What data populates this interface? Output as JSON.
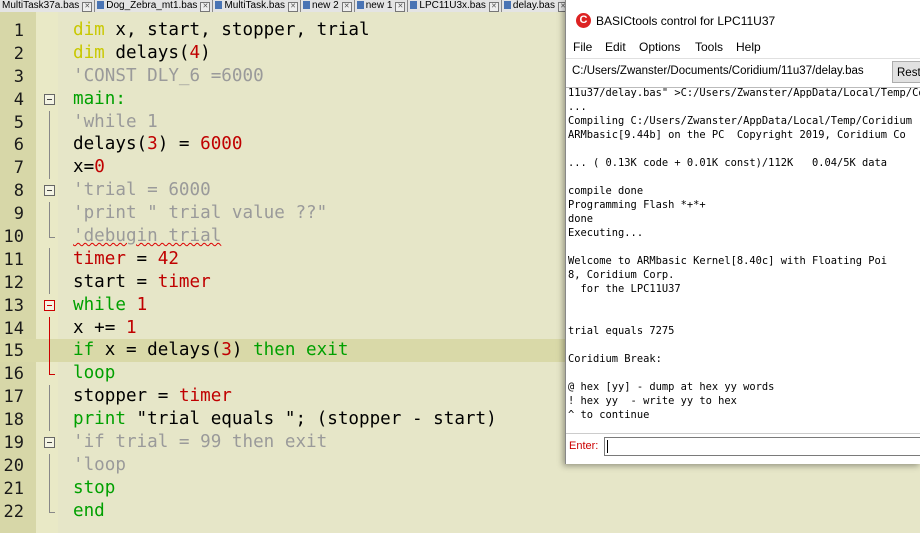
{
  "tabs": [
    {
      "label": "MultiTask37a.bas"
    },
    {
      "label": "Dog_Zebra_mt1.bas"
    },
    {
      "label": "MultiTask.bas"
    },
    {
      "label": "new 2"
    },
    {
      "label": "new 1"
    },
    {
      "label": "LPC11U3x.bas"
    },
    {
      "label": "delay.bas"
    }
  ],
  "colors": {
    "keyword": "#c8c800",
    "identifier": "#000000",
    "number": "#c00000",
    "comment": "#9a9a9a",
    "flow_keyword": "#00a000",
    "operator": "#c00000",
    "timer": "#c00000",
    "string": "#000000"
  },
  "editor": {
    "current_line": 15,
    "lines": [
      {
        "num": "1",
        "tokens": [
          [
            "kw",
            "dim"
          ],
          [
            "id",
            " x, start, stopper, trial"
          ]
        ]
      },
      {
        "num": "2",
        "tokens": [
          [
            "kw",
            "dim"
          ],
          [
            "id",
            " delays("
          ],
          [
            "num",
            "4"
          ],
          [
            "id",
            ")"
          ]
        ]
      },
      {
        "num": "3",
        "tokens": [
          [
            "cm",
            "'CONST DLY_6 =6000"
          ]
        ]
      },
      {
        "num": "4",
        "tokens": [
          [
            "fk",
            "main:"
          ]
        ]
      },
      {
        "num": "5",
        "tokens": [
          [
            "cm",
            "'while 1"
          ]
        ]
      },
      {
        "num": "6",
        "tokens": [
          [
            "id",
            "delays("
          ],
          [
            "num",
            "3"
          ],
          [
            "id",
            ") = "
          ],
          [
            "num",
            "6000"
          ]
        ]
      },
      {
        "num": "7",
        "tokens": [
          [
            "id",
            "x="
          ],
          [
            "num",
            "0"
          ]
        ]
      },
      {
        "num": "8",
        "tokens": [
          [
            "cm",
            "'trial = 6000"
          ]
        ]
      },
      {
        "num": "9",
        "tokens": [
          [
            "cm",
            "'print \" trial value ??\""
          ]
        ]
      },
      {
        "num": "10",
        "tokens": [
          [
            "cm",
            "'debugin trial"
          ]
        ]
      },
      {
        "num": "11",
        "tokens": [
          [
            "tm",
            "timer"
          ],
          [
            "id",
            " = "
          ],
          [
            "num",
            "42"
          ]
        ]
      },
      {
        "num": "12",
        "tokens": [
          [
            "id",
            "start = "
          ],
          [
            "tm",
            "timer"
          ]
        ]
      },
      {
        "num": "13",
        "tokens": [
          [
            "fk",
            "while"
          ],
          [
            "id",
            " "
          ],
          [
            "num",
            "1"
          ]
        ]
      },
      {
        "num": "14",
        "tokens": [
          [
            "id",
            "x += "
          ],
          [
            "num",
            "1"
          ]
        ]
      },
      {
        "num": "15",
        "tokens": [
          [
            "fk",
            "if"
          ],
          [
            "id",
            " x = delays("
          ],
          [
            "num",
            "3"
          ],
          [
            "id",
            ") "
          ],
          [
            "fk",
            "then"
          ],
          [
            "id",
            " "
          ],
          [
            "fk",
            "exit"
          ]
        ]
      },
      {
        "num": "16",
        "tokens": [
          [
            "fk",
            "loop"
          ]
        ]
      },
      {
        "num": "17",
        "tokens": [
          [
            "id",
            "stopper = "
          ],
          [
            "tm",
            "timer"
          ]
        ]
      },
      {
        "num": "18",
        "tokens": [
          [
            "fk",
            "print"
          ],
          [
            "id",
            " \"trial equals \"; (stopper - start)"
          ]
        ]
      },
      {
        "num": "19",
        "tokens": [
          [
            "cm",
            "'if trial = 99 then exit"
          ]
        ]
      },
      {
        "num": "20",
        "tokens": [
          [
            "cm",
            "'loop"
          ]
        ]
      },
      {
        "num": "21",
        "tokens": [
          [
            "fk",
            "stop"
          ]
        ]
      },
      {
        "num": "22",
        "tokens": [
          [
            "fk",
            "end"
          ]
        ]
      }
    ]
  },
  "basictools": {
    "title": "BASICtools control for LPC11U37",
    "menu": [
      "File",
      "Edit",
      "Options",
      "Tools",
      "Help"
    ],
    "path": "C:/Users/Zwanster/Documents/Coridium/11u37/delay.bas",
    "rest_button": "Rest",
    "console_lines": [
      "11u37/delay.bas\" >C:/Users/Zwanster/AppData/Local/Temp/Cor",
      "...",
      "Compiling C:/Users/Zwanster/AppData/Local/Temp/Coridium",
      "ARMbasic[9.44b] on the PC  Copyright 2019, Coridium Co",
      "",
      "... ( 0.13K code + 0.01K const)/112K   0.04/5K data",
      "",
      "compile done",
      "Programming Flash *+*+",
      "done",
      "Executing...",
      "",
      "Welcome to ARMbasic Kernel[8.40c] with Floating Poi",
      "8, Coridium Corp.",
      "  for the LPC11U37",
      "",
      "",
      "trial equals 7275",
      "",
      "Coridium Break:",
      "",
      "@ hex [yy] - dump at hex yy words",
      "! hex yy  - write yy to hex",
      "^ to continue"
    ],
    "enter_label": "Enter:",
    "enter_value": ""
  }
}
